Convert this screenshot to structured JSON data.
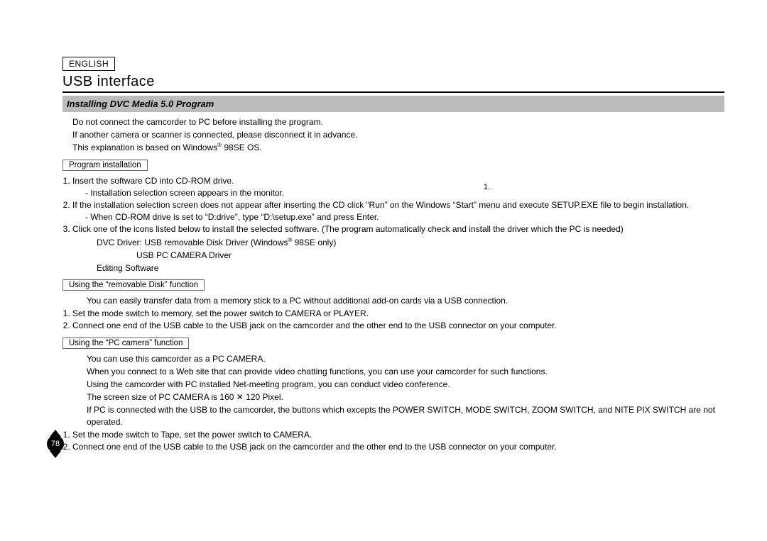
{
  "language_label": "ENGLISH",
  "title": "USB interface",
  "section_bar": "Installing DVC Media 5.0 Program",
  "intro": {
    "l1": "Do not connect the camcorder to PC before installing the program.",
    "l2": "If another camera or scanner is connected, please disconnect it in advance.",
    "l3_a": "This explanation is based on Windows",
    "l3_sup": "®",
    "l3_b": " 98SE OS."
  },
  "box1": "Program installation",
  "fig_label": "1.",
  "install": {
    "li1": "Insert the software CD into CD-ROM drive.",
    "li1_dash": "Installation selection screen appears in the monitor.",
    "li2": "If the installation selection screen does not appear after inserting the CD click “Run” on the Windows “Start” menu and execute SETUP.EXE file to begin installation.",
    "li2_dash": "When CD-ROM drive is set to “D:drive”, type “D:\\setup.exe” and press Enter.",
    "li3": "Click one of the icons listed below to install the selected software. (The program automatically check and install the driver which the PC is needed)",
    "sub1_a": "DVC Driver: USB removable Disk Driver (Windows",
    "sub1_sup": "®",
    "sub1_b": " 98SE only)",
    "sub1_c": "USB PC CAMERA Driver",
    "sub2": "Editing Software"
  },
  "box2": "Using the “removable Disk” function",
  "removable": {
    "p1": "You can easily transfer data from a memory stick to a PC without additional add-on cards via a USB connection.",
    "li1": "Set the mode switch to memory, set the power switch to CAMERA or PLAYER.",
    "li2": "Connect one end of the USB cable to the USB jack on the camcorder and the other end to the USB connector on your computer."
  },
  "box3": "Using the “PC camera” function",
  "pccam": {
    "p1": "You can use this camcorder as a PC CAMERA.",
    "p2": "When you connect to a Web site that can provide video chatting functions, you can use your camcorder for such functions.",
    "p3": "Using the camcorder with PC installed Net-meeting program, you can conduct video conference.",
    "p4": "The screen size of PC CAMERA is 160 ✕ 120 Pixel.",
    "p5": "If PC is connected with the USB to the camcorder, the buttons which excepts the POWER SWITCH, MODE SWITCH, ZOOM SWITCH, and NITE PIX SWITCH are not operated.",
    "li1": "Set the mode switch to Tape, set the power switch to CAMERA.",
    "li2": "Connect one end of the USB cable to the USB jack on the camcorder and the other end to the USB connector on your computer."
  },
  "page_number": "78"
}
